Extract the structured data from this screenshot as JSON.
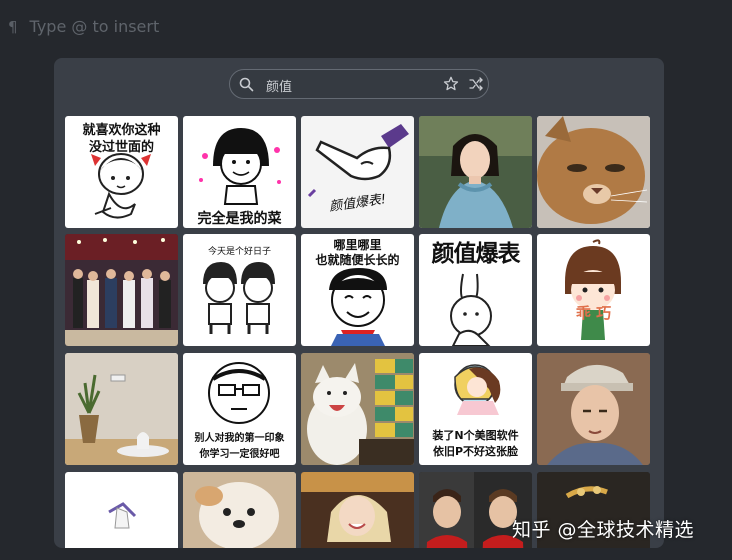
{
  "editor": {
    "pilcrow": "¶",
    "placeholder": "Type @ to insert"
  },
  "search": {
    "query": "颜值",
    "search_icon": "search-icon",
    "favorite_icon": "star-icon",
    "shuffle_icon": "shuffle-icon"
  },
  "stickers": {
    "t1": "就喜欢你这种",
    "t1b": "没过世面的",
    "t2": "完全是我的菜",
    "t3": "颜值爆表!",
    "t8": "今天是个好日子",
    "t9a": "哪里哪里",
    "t9b": "也就随便长长的",
    "t10": "颜值爆表",
    "t11": "乖 巧",
    "t13a": "别人对我的第一印象",
    "t13b": "你学习一定很好吧",
    "t15a": "装了N个美图软件",
    "t15b": "依旧P不好这张脸"
  },
  "watermark": "知乎 @全球技术精选",
  "colors": {
    "background": "#25282d",
    "panel": "#3a3f47",
    "search_border": "#646a73"
  }
}
